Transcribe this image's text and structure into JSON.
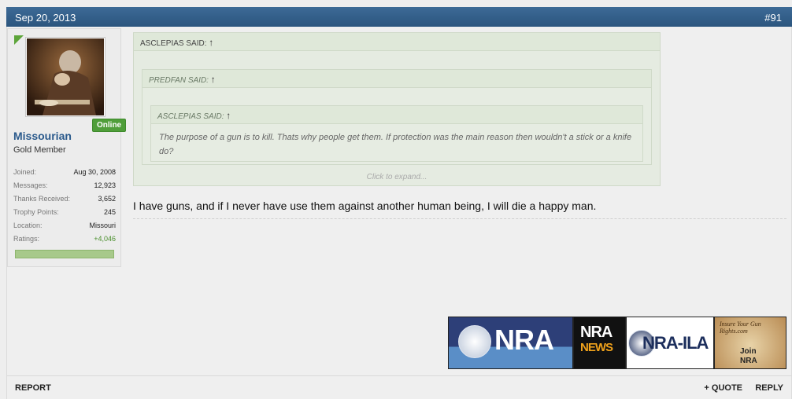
{
  "header": {
    "date": "Sep 20, 2013",
    "post_number": "#91"
  },
  "user": {
    "name": "Missourian",
    "title": "Gold Member",
    "online_badge": "Online",
    "stats": [
      {
        "label": "Joined:",
        "value": "Aug 30, 2008"
      },
      {
        "label": "Messages:",
        "value": "12,923"
      },
      {
        "label": "Thanks Received:",
        "value": "3,652"
      },
      {
        "label": "Trophy Points:",
        "value": "245"
      },
      {
        "label": "Location:",
        "value": "Missouri"
      },
      {
        "label": "Ratings:",
        "value": "+4,046"
      }
    ],
    "rating_fill": 1.0
  },
  "quotes": {
    "outer_author": "ASCLEPIAS SAID:",
    "middle_author": "PREDFAN SAID:",
    "inner_author": "ASCLEPIAS SAID:",
    "inner_text": "The purpose of a gun is to kill. Thats why people get them. If protection was the main reason then wouldn't a stick or a knife do?",
    "expand_label": "Click to expand...",
    "up_arrow": "↑"
  },
  "message": "I have guns, and if I never have use them against another human being, I will die a happy man.",
  "signature": {
    "nra": "NRA",
    "nra_news_top": "NRA",
    "nra_news_bottom": "NEWS",
    "nra_ila": "NRA-ILA",
    "insure_text": "Insure Your Gun Rights.com",
    "join": "Join",
    "join_nra": "NRA"
  },
  "footer": {
    "report": "REPORT",
    "quote": "+ QUOTE",
    "reply": "REPLY"
  },
  "colors": {
    "header": "#2b557e",
    "username": "#2b5a8c",
    "online": "#4f9e3a",
    "rating_positive": "#4a8f2c"
  }
}
